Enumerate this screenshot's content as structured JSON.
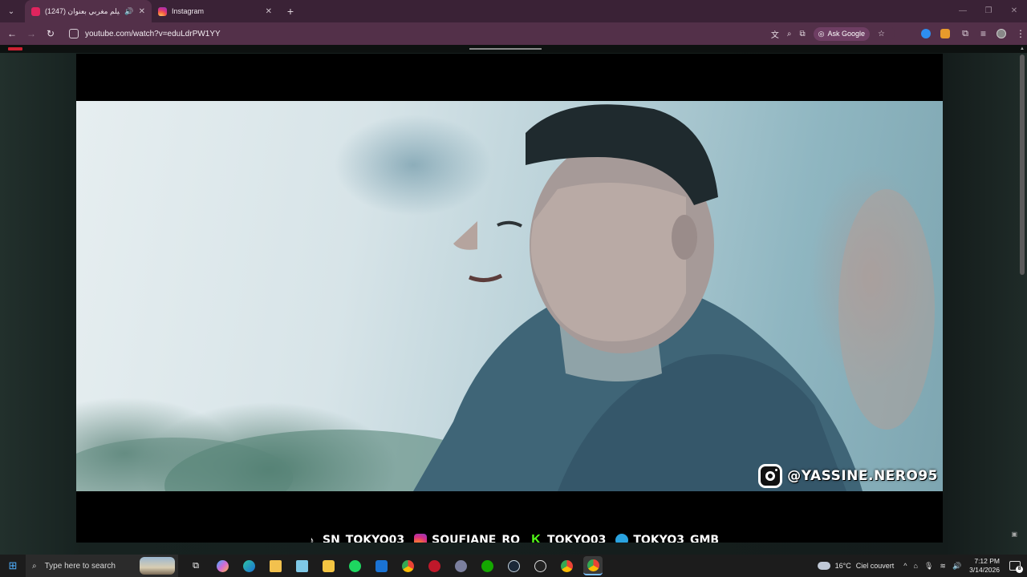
{
  "browser": {
    "tabs": [
      {
        "title": "(1247) فيلم مغربي بعنوان",
        "favicon": "youtube-icon",
        "audio": true,
        "active": true
      },
      {
        "title": "Instagram",
        "favicon": "instagram-icon",
        "audio": false,
        "active": false
      }
    ],
    "new_tab_label": "+",
    "url": "youtube.com/watch?v=eduLdrPW1YY",
    "ask_google_label": "Ask Google"
  },
  "video": {
    "watermark_handle": "@YASSINE.NERO95",
    "credits": [
      {
        "icon": "tiktok-icon",
        "text": "SN_TOKYO03"
      },
      {
        "icon": "instagram-icon",
        "text": "SOUFIANE_RO"
      },
      {
        "icon": "kick-icon",
        "text": "TOKYO03"
      },
      {
        "icon": "telegram-icon",
        "text": "TOKYO3_GMB"
      }
    ]
  },
  "taskbar": {
    "search_placeholder": "Type here to search",
    "weather": {
      "temperature": "16°C",
      "condition": "Ciel couvert"
    },
    "time": "7:12 PM",
    "date": "3/14/2026",
    "notification_count": "8",
    "apps": [
      "task-view-icon",
      "copilot-icon",
      "edge-icon",
      "file-explorer-icon",
      "notepad-icon",
      "store-icon",
      "spotify-icon",
      "outlook-icon",
      "chrome-icon",
      "app-red-icon",
      "discord-icon",
      "upwork-icon",
      "steam-icon",
      "app-dark-icon",
      "chrome-icon",
      "chrome-active-icon"
    ]
  },
  "colors": {
    "tabstrip": "#3a2236",
    "toolbar": "#533049",
    "taskbar": "#1c1c1c",
    "accent": "#7cc0ff"
  }
}
